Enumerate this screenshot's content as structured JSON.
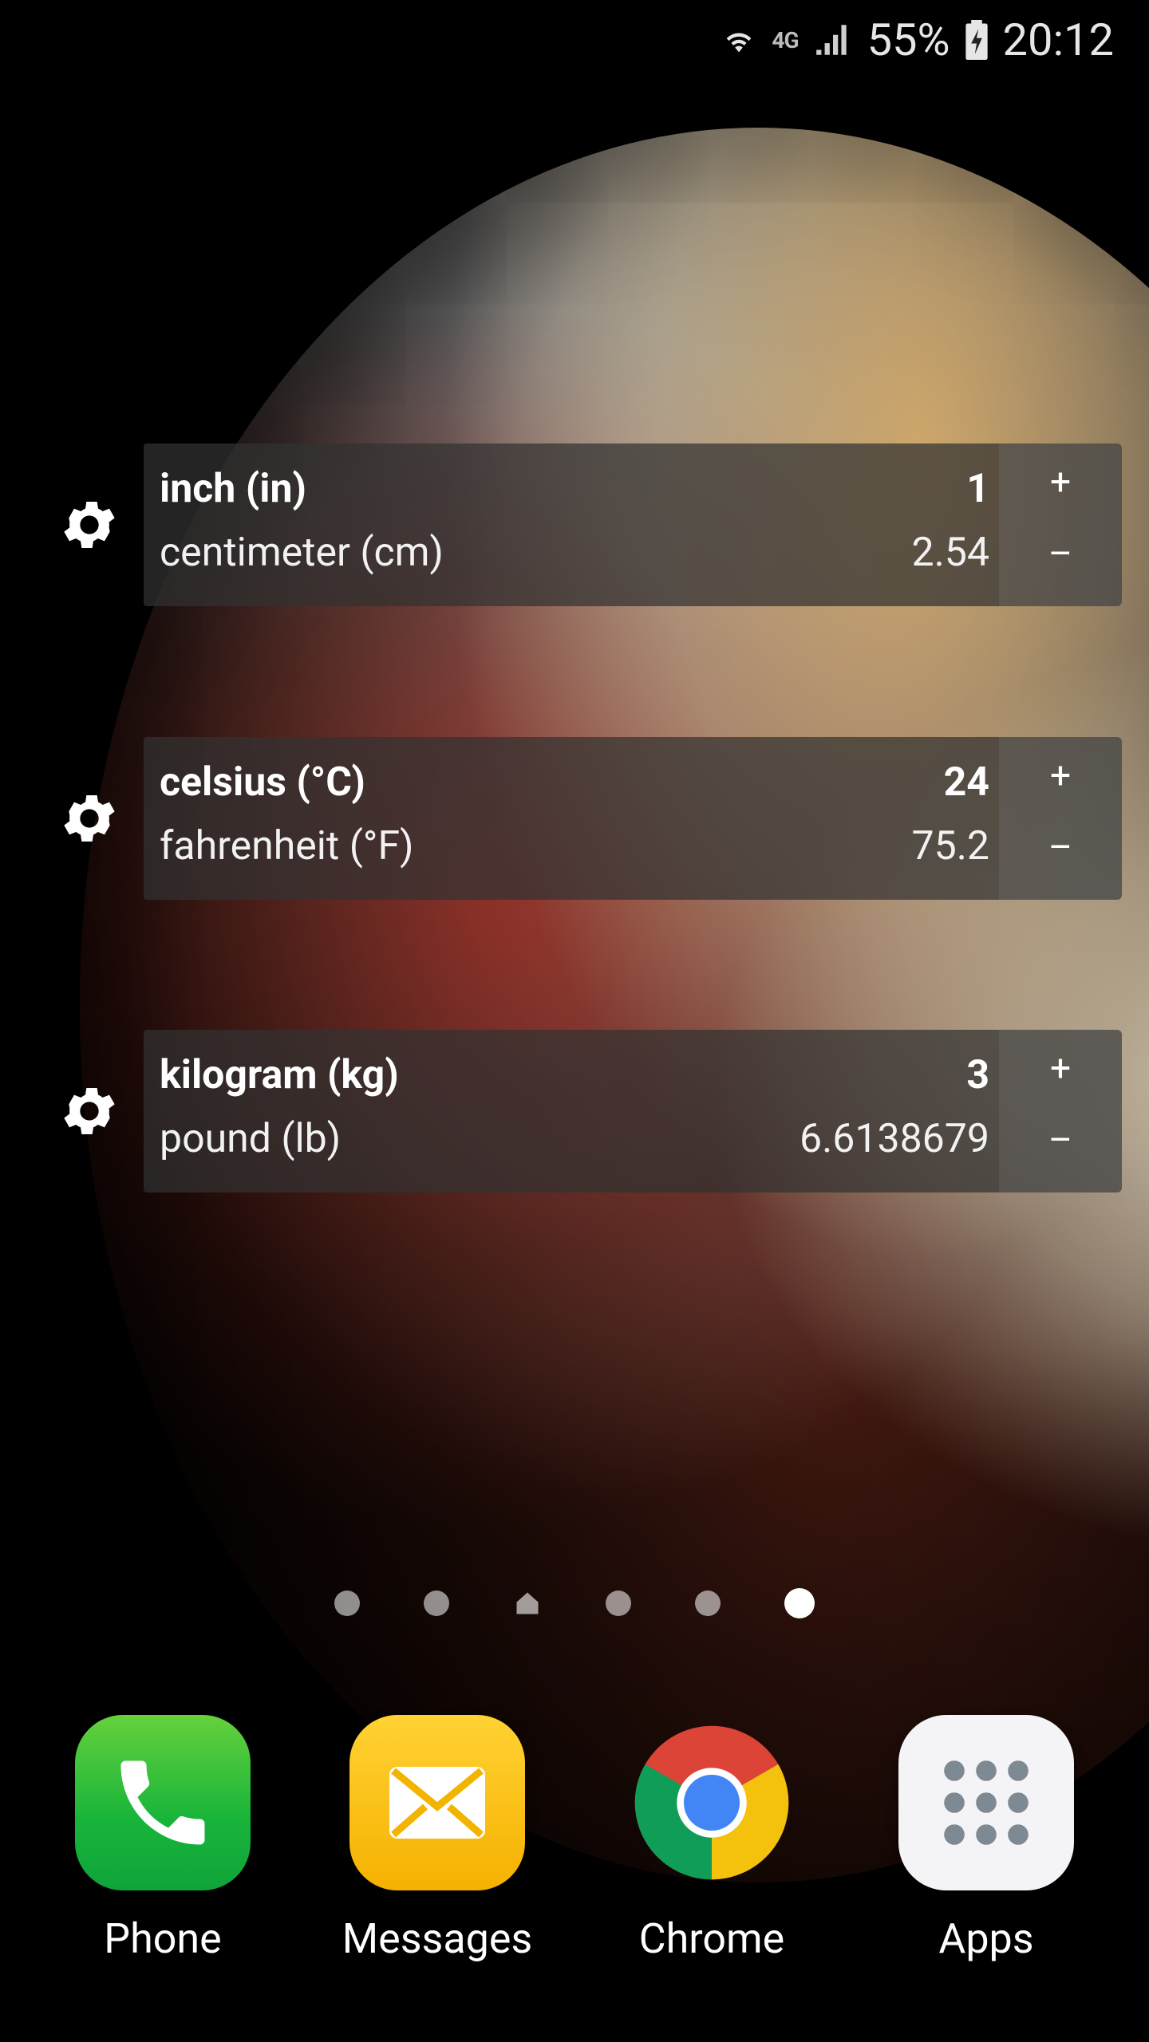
{
  "status_bar": {
    "network": "4G",
    "battery_percent": "55%",
    "time": "20:12"
  },
  "widgets": [
    {
      "from_unit": "inch (in)",
      "from_value": "1",
      "to_unit": "centimeter (cm)",
      "to_value": "2.54",
      "plus_label": "+",
      "minus_label": "–"
    },
    {
      "from_unit": "celsius (°C)",
      "from_value": "24",
      "to_unit": "fahrenheit (°F)",
      "to_value": "75.2",
      "plus_label": "+",
      "minus_label": "–"
    },
    {
      "from_unit": "kilogram (kg)",
      "from_value": "3",
      "to_unit": "pound (lb)",
      "to_value": "6.6138679",
      "plus_label": "+",
      "minus_label": "–"
    }
  ],
  "pager": {
    "pages": 6,
    "home_index": 2,
    "active_index": 5
  },
  "dock": {
    "apps": [
      {
        "label": "Phone",
        "icon": "phone-icon"
      },
      {
        "label": "Messages",
        "icon": "messages-icon"
      },
      {
        "label": "Chrome",
        "icon": "chrome-icon"
      },
      {
        "label": "Apps",
        "icon": "apps-grid-icon"
      }
    ]
  }
}
